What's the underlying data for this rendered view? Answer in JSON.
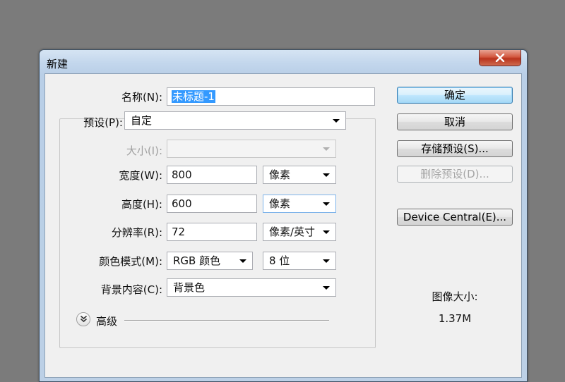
{
  "window": {
    "title": "新建"
  },
  "fields": {
    "name": {
      "label": "名称(N):",
      "value": "未标题-1"
    },
    "preset": {
      "label": "预设(P):",
      "value": "自定"
    },
    "size": {
      "label": "大小(I):",
      "value": ""
    },
    "width": {
      "label": "宽度(W):",
      "value": "800",
      "unit": "像素"
    },
    "height": {
      "label": "高度(H):",
      "value": "600",
      "unit": "像素"
    },
    "resolution": {
      "label": "分辨率(R):",
      "value": "72",
      "unit": "像素/英寸"
    },
    "color_mode": {
      "label": "颜色模式(M):",
      "value": "RGB 颜色",
      "depth": "8 位"
    },
    "background": {
      "label": "背景内容(C):",
      "value": "背景色"
    }
  },
  "advanced": {
    "label": "高级"
  },
  "buttons": {
    "ok": "确定",
    "cancel": "取消",
    "save_preset": "存储预设(S)...",
    "delete_preset": "删除预设(D)...",
    "device_central": "Device Central(E)..."
  },
  "image_size": {
    "label": "图像大小:",
    "value": "1.37M"
  },
  "colors": {
    "selection": "#3399ff",
    "default_button": "#bee6fd",
    "close_button": "#c8442b"
  }
}
